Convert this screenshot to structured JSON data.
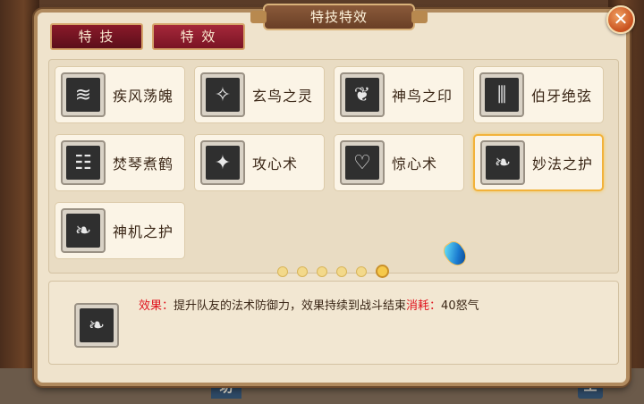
{
  "window": {
    "title": "特技特效",
    "close_glyph": "✕"
  },
  "tabs": [
    {
      "label": "特 技",
      "active": true
    },
    {
      "label": "特 效",
      "active": false
    }
  ],
  "skills": [
    {
      "name": "疾风荡魄",
      "icon": "wind-swirl-icon",
      "selected": false
    },
    {
      "name": "玄鸟之灵",
      "icon": "bird-spirit-icon",
      "selected": false
    },
    {
      "name": "神鸟之印",
      "icon": "divine-bird-seal-icon",
      "selected": false
    },
    {
      "name": "伯牙绝弦",
      "icon": "zither-strings-icon",
      "selected": false
    },
    {
      "name": "焚琴煮鹤",
      "icon": "burning-zither-icon",
      "selected": false
    },
    {
      "name": "攻心术",
      "icon": "mind-attack-icon",
      "selected": false
    },
    {
      "name": "惊心术",
      "icon": "heart-shock-icon",
      "selected": false
    },
    {
      "name": "妙法之护",
      "icon": "feather-icon",
      "selected": true
    },
    {
      "name": "神机之护",
      "icon": "feather-icon",
      "selected": false
    }
  ],
  "pager": {
    "count": 6,
    "active_index": 5
  },
  "detail": {
    "icon": "feather-icon",
    "effect_label": "效果：",
    "effect_text": "提升队友的法术防御力，效果持续到战斗结束",
    "cost_label": "消耗：",
    "cost_text": "40怒气"
  },
  "scene": {
    "sign_left": "坊",
    "sign_right": "生"
  },
  "colors": {
    "tab_red": "#8a1a2a",
    "highlight_gold": "#f2b23a",
    "detail_red": "#e0141e"
  }
}
